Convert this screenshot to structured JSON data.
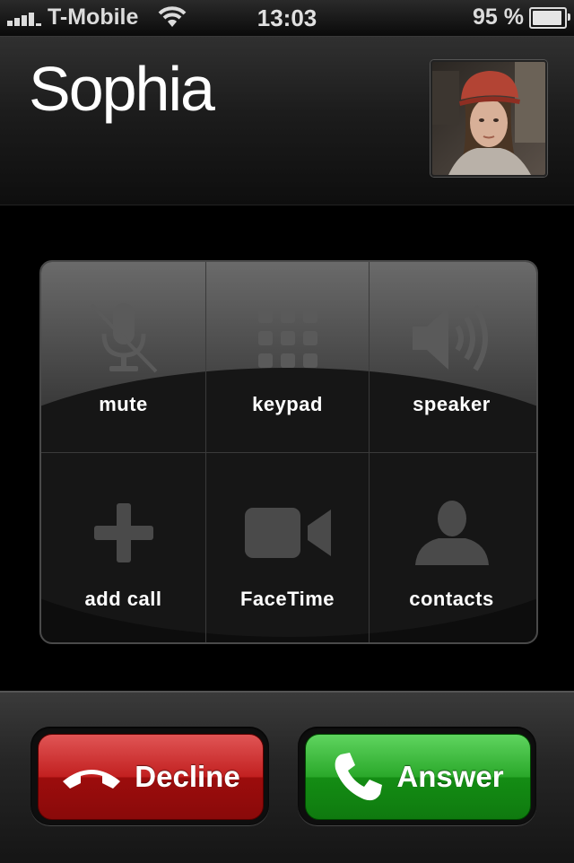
{
  "status_bar": {
    "carrier": "T-Mobile",
    "time": "13:03",
    "battery_percent": "95 %",
    "battery_level": 0.95,
    "signal_bars": 4,
    "icons": [
      "signal-bars-icon",
      "wifi-icon",
      "battery-icon"
    ]
  },
  "caller": {
    "name": "Sophia",
    "photo_icon": "caller-photo"
  },
  "controls": {
    "mute": "mute",
    "keypad": "keypad",
    "speaker": "speaker",
    "add_call": "add call",
    "facetime": "FaceTime",
    "contacts": "contacts"
  },
  "actions": {
    "decline": "Decline",
    "answer": "Answer"
  },
  "colors": {
    "decline": "#c22020",
    "answer": "#2aa82a",
    "disabled_icon": "#5a5a5a"
  }
}
